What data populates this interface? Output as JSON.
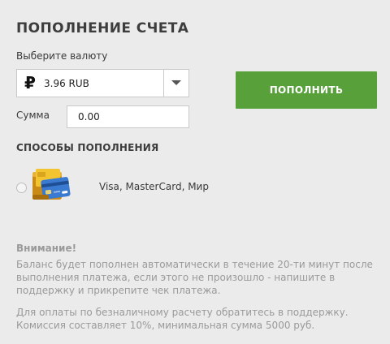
{
  "page": {
    "title": "ПОПОЛНЕНИЕ СЧЕТА"
  },
  "currency": {
    "label": "Выберите валюту",
    "symbol": "₽",
    "selected_value": "3.96 RUB"
  },
  "topup_button": {
    "label": "ПОПОЛНИТЬ"
  },
  "amount": {
    "label": "Сумма",
    "value": "0.00"
  },
  "methods": {
    "title": "СПОСОБЫ ПОПОЛНЕНИЯ",
    "items": [
      {
        "label": "Visa, MasterCard, Мир",
        "icon": "credit-card-icon",
        "selected": false
      }
    ]
  },
  "notice": {
    "title": "Внимание!",
    "text": "Баланс будет пополнен автоматически в течение 20-ти минут после выполнения платежа, если этого не произошло - напишите в поддержку и прикрепите чек платежа.",
    "cashless_line1": "Для оплаты по безналичному расчету обратитесь в поддержку.",
    "cashless_line2": "Комиссия составляет 10%, минимальная сумма 5000 руб."
  },
  "colors": {
    "background": "#ebebeb",
    "accent_button": "#58a03a",
    "muted_text": "#9a9a9a"
  }
}
